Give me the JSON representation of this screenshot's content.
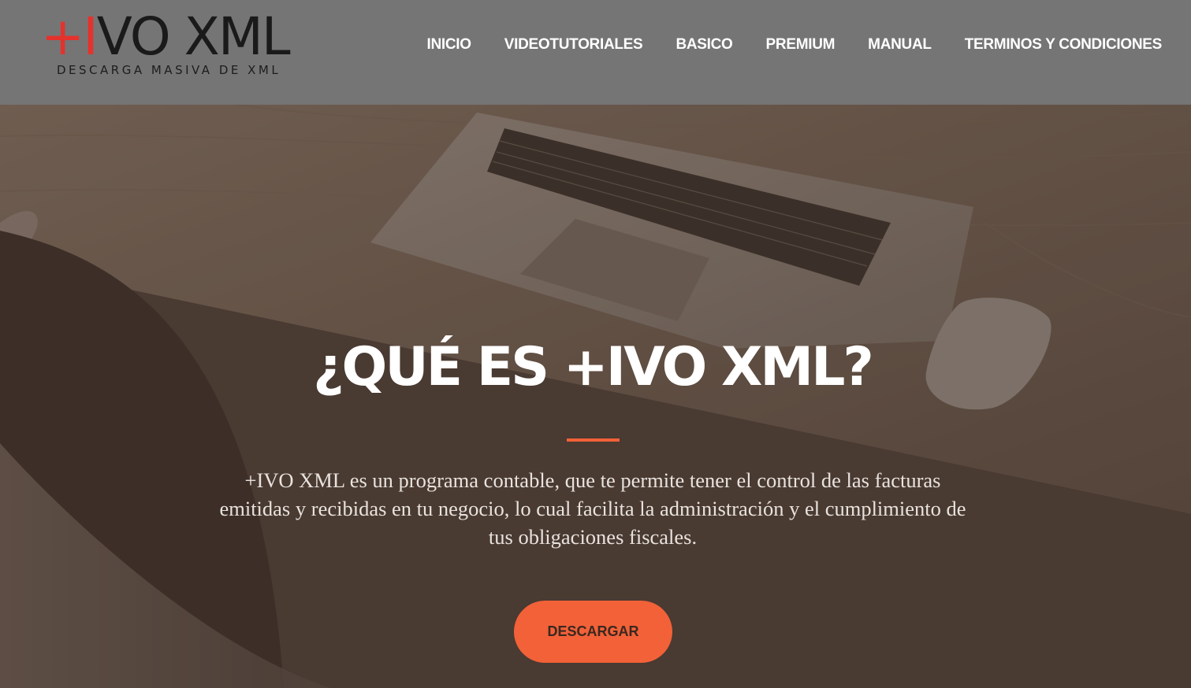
{
  "header": {
    "logo": {
      "accent": "+I",
      "main": "VO XML",
      "tagline": "DESCARGA MASIVA DE XML"
    },
    "nav": [
      {
        "label": "INICIO"
      },
      {
        "label": "VIDEOTUTORIALES"
      },
      {
        "label": "BASICO"
      },
      {
        "label": "PREMIUM"
      },
      {
        "label": "MANUAL"
      },
      {
        "label": "TERMINOS Y CONDICIONES"
      }
    ]
  },
  "hero": {
    "title": "¿QUÉ ES +IVO XML?",
    "description": "+IVO XML es un programa contable, que te permite tener el control de las facturas emitidas y recibidas en tu negocio, lo cual facilita la administración y el cumplimiento de tus obligaciones fiscales.",
    "cta_label": "DESCARGAR",
    "background_image": "laptop-and-mouse-on-desk-photo"
  },
  "colors": {
    "header_bg": "#757575",
    "accent": "#f26138",
    "logo_red": "#e5322d",
    "hero_overlay": "#4e4039"
  }
}
